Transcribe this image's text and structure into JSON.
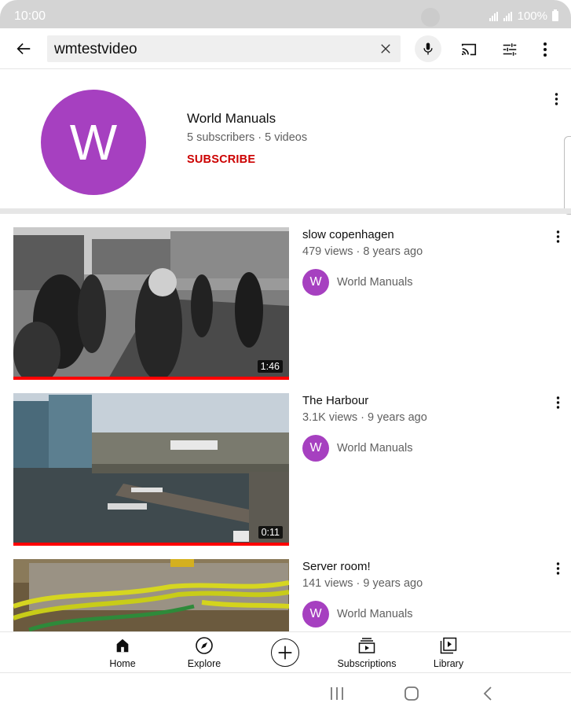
{
  "status_bar": {
    "time": "10:00",
    "battery": "100%",
    "signal_icon": "signal-icon",
    "battery_icon": "battery-icon"
  },
  "search": {
    "query": "wmtestvideo",
    "back_icon": "arrow-left-icon",
    "clear_icon": "close-icon",
    "mic_icon": "microphone-icon",
    "cast_icon": "cast-icon",
    "filter_icon": "filter-sliders-icon",
    "more_icon": "more-vertical-icon"
  },
  "channel": {
    "initial": "W",
    "name": "World Manuals",
    "meta": "5 subscribers · 5 videos",
    "subscribe_label": "SUBSCRIBE",
    "avatar_color": "#a640c0",
    "subscribe_color": "#cc0000"
  },
  "videos": [
    {
      "title": "slow copenhagen",
      "meta": "479 views · 8 years ago",
      "duration": "1:46",
      "channel_initial": "W",
      "channel_name": "World Manuals",
      "watched_fraction": 1.0
    },
    {
      "title": "The Harbour",
      "meta": "3.1K views · 9 years ago",
      "duration": "0:11",
      "channel_initial": "W",
      "channel_name": "World Manuals",
      "watched_fraction": 1.0
    },
    {
      "title": "Server room!",
      "meta": "141 views · 9 years ago",
      "duration": "",
      "channel_initial": "W",
      "channel_name": "World Manuals",
      "watched_fraction": 0
    }
  ],
  "bottom_nav": {
    "items": [
      {
        "label": "Home",
        "icon": "home-icon"
      },
      {
        "label": "Explore",
        "icon": "compass-icon"
      },
      {
        "label": "",
        "icon": "create-plus-icon"
      },
      {
        "label": "Subscriptions",
        "icon": "subscriptions-icon"
      },
      {
        "label": "Library",
        "icon": "library-icon"
      }
    ]
  },
  "system_nav": {
    "recents_icon": "recents-icon",
    "home_icon": "home-circle-icon",
    "back_icon": "chevron-left-icon"
  },
  "colors": {
    "progress": "#ff0000",
    "secondary_text": "#606060"
  }
}
